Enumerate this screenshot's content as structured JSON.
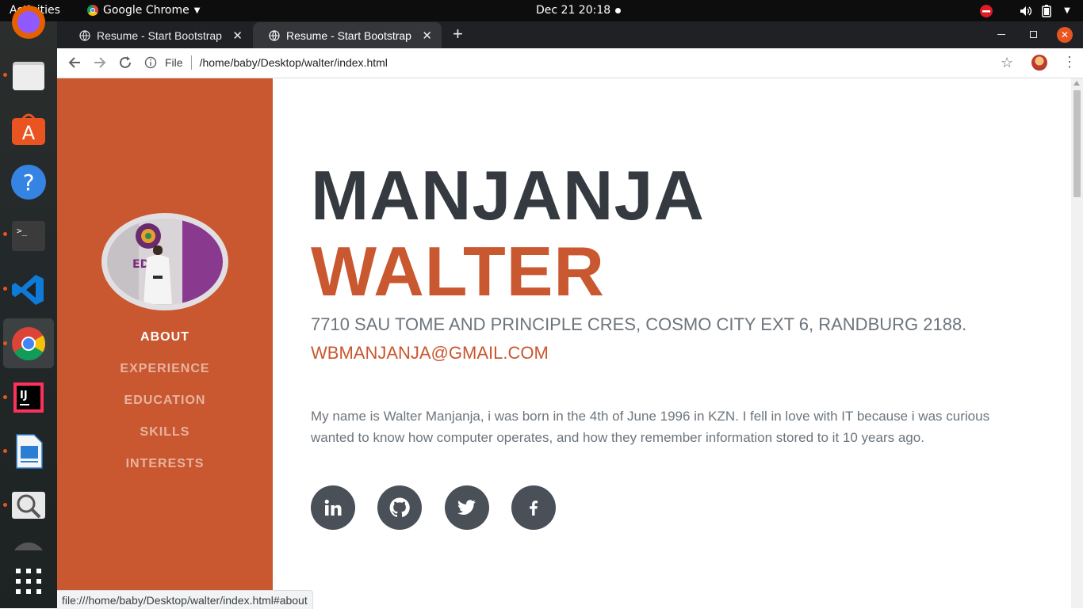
{
  "topbar": {
    "activities": "Activities",
    "app_name": "Google Chrome",
    "clock": "Dec 21  20:18"
  },
  "dock": {
    "items": [
      {
        "name": "firefox"
      },
      {
        "name": "files",
        "running": true
      },
      {
        "name": "ubuntu-software"
      },
      {
        "name": "help"
      },
      {
        "name": "terminal",
        "running": true
      },
      {
        "name": "vscode",
        "running": true
      },
      {
        "name": "chrome",
        "running": true,
        "active": true
      },
      {
        "name": "intellij",
        "running": true
      },
      {
        "name": "libreoffice-writer",
        "running": true
      },
      {
        "name": "image-viewer",
        "running": true
      },
      {
        "name": "show-applications"
      }
    ]
  },
  "browser": {
    "tabs": [
      {
        "title": "Resume - Start Bootstrap",
        "active": false
      },
      {
        "title": "Resume - Start Bootstrap",
        "active": true
      }
    ],
    "new_tab": "+",
    "address": {
      "scheme_label": "File",
      "url": "/home/baby/Desktop/walter/index.html"
    },
    "status_url": "file:///home/baby/Desktop/walter/index.html#about"
  },
  "sidebar": {
    "nav": [
      {
        "label": "ABOUT",
        "active": true
      },
      {
        "label": "EXPERIENCE",
        "active": false
      },
      {
        "label": "EDUCATION",
        "active": false
      },
      {
        "label": "SKILLS",
        "active": false
      },
      {
        "label": "INTERESTS",
        "active": false
      }
    ]
  },
  "profile": {
    "first_name": "MANJANJA",
    "last_name": "WALTER",
    "address": "7710 SAU TOME AND PRINCIPLE CRES, COSMO CITY EXT 6, RANDBURG 2188.",
    "email": "WBMANJANJA@GMAIL.COM",
    "about": "My name is Walter Manjanja, i was born in the 4th of June 1996 in KZN. I fell in love with IT because i was curious wanted to know how computer operates, and how they remember information stored to it 10 years ago.",
    "social": [
      "linkedin-icon",
      "github-icon",
      "twitter-icon",
      "facebook-icon"
    ]
  },
  "colors": {
    "primary": "#c9572f",
    "heading": "#343a40",
    "muted": "#6c757d",
    "social_bg": "#495057"
  }
}
